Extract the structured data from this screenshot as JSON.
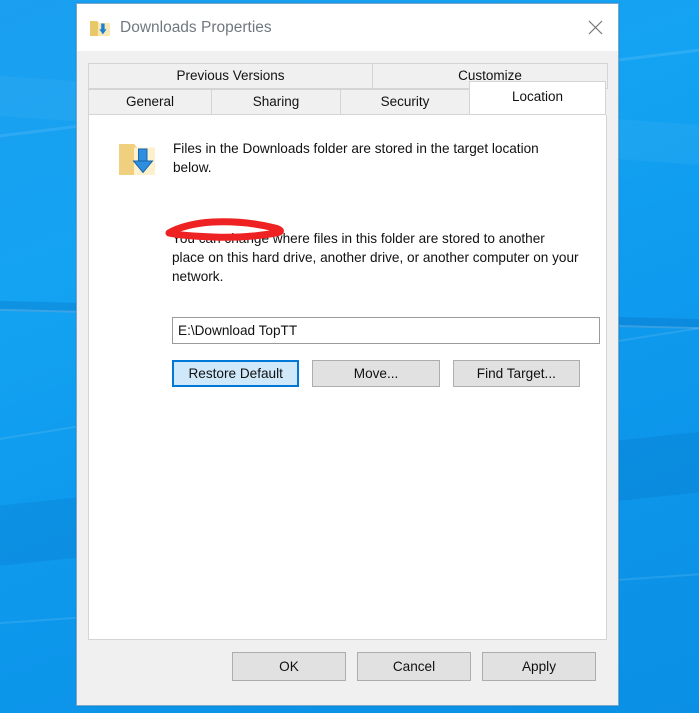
{
  "window": {
    "title": "Downloads Properties",
    "title_icon": "downloads-folder-icon",
    "close_icon": "close-icon"
  },
  "tabs": {
    "row1": [
      {
        "label": "Previous Versions",
        "active": false
      },
      {
        "label": "Customize",
        "active": false
      }
    ],
    "row2": [
      {
        "label": "General",
        "active": false
      },
      {
        "label": "Sharing",
        "active": false
      },
      {
        "label": "Security",
        "active": false
      },
      {
        "label": "Location",
        "active": true
      }
    ]
  },
  "location_panel": {
    "icon": "downloads-folder-icon-large",
    "description": "Files in the Downloads folder are stored in the target location below.",
    "explanation": "You can change where files in this folder are stored to another place on this hard drive, another drive, or another computer on your network.",
    "path_value": "E:\\Download TopTT",
    "path_placeholder": "",
    "buttons": [
      {
        "label": "Restore Default",
        "focused": true
      },
      {
        "label": "Move...",
        "focused": false
      },
      {
        "label": "Find Target...",
        "focused": false
      }
    ],
    "annotation": {
      "shape": "red-ellipse-scribble",
      "color": "#ee2222",
      "points_at": "Restore Default"
    }
  },
  "footer": {
    "buttons": [
      {
        "label": "OK"
      },
      {
        "label": "Cancel"
      },
      {
        "label": "Apply"
      }
    ]
  },
  "colors": {
    "desktop": "#0e9aee",
    "dialog_bg": "#f0f0f0",
    "panel_bg": "#ffffff",
    "focus_border": "#0078d7",
    "focus_fill": "#cfe8fa",
    "annotation": "#ee2222",
    "title_text": "#6f7880"
  }
}
